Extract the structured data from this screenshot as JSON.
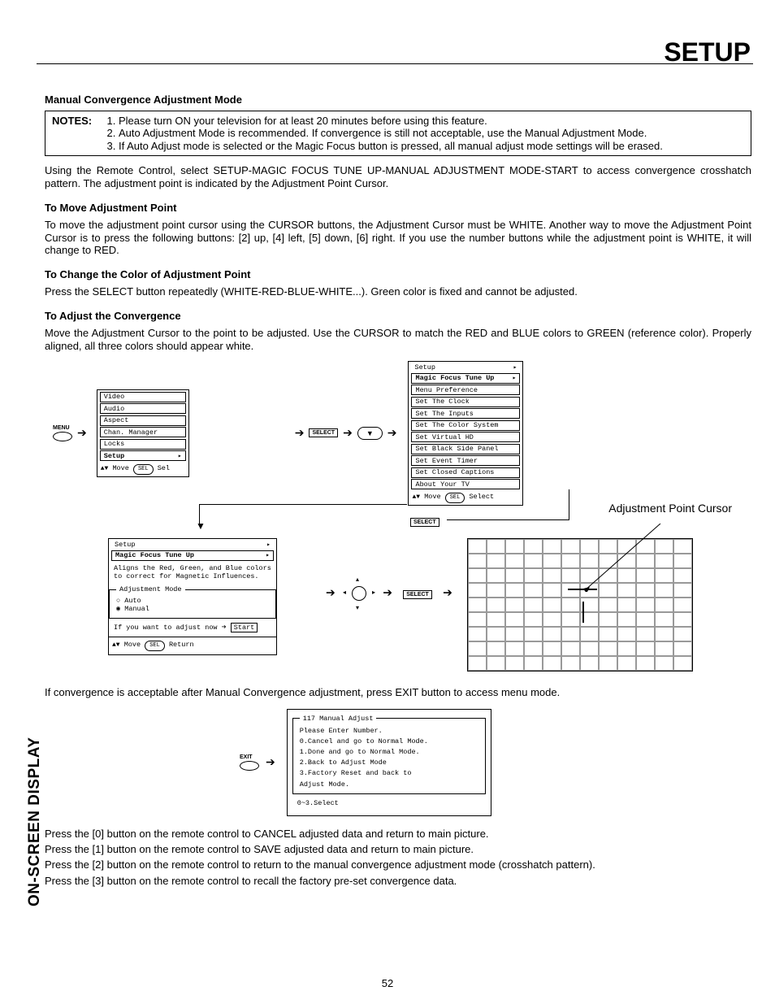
{
  "title": "Setup",
  "section_heading": "Manual Convergence Adjustment Mode",
  "notes_label": "NOTES:",
  "notes": [
    "Please turn ON your television for at least 20 minutes before using this feature.",
    "Auto Adjustment Mode is recommended.  If convergence is still not acceptable, use the Manual Adjustment Mode.",
    "If Auto Adjust mode is selected or the Magic Focus button is pressed, all manual adjust mode settings will be erased."
  ],
  "intro": "Using the Remote Control, select SETUP-MAGIC FOCUS TUNE UP-MANUAL ADJUSTMENT MODE-START to access convergence crosshatch pattern.  The adjustment point is indicated by the Adjustment Point Cursor.",
  "move_h": "To Move Adjustment Point",
  "move_p": "To move the adjustment point cursor using the CURSOR buttons, the Adjustment Cursor must be WHITE.  Another way to move the Adjustment Point Cursor is to press the following buttons:  [2] up, [4] left, [5] down, [6] right.  If you use the number buttons while the adjustment point is WHITE, it will change to RED.",
  "color_h": "To Change the Color of Adjustment Point",
  "color_p": "Press the SELECT button repeatedly (WHITE-RED-BLUE-WHITE...).  Green color is fixed and cannot be adjusted.",
  "adjust_h": "To Adjust the Convergence",
  "adjust_p": "Move the Adjustment Cursor to the point to be adjusted.  Use the CURSOR to match the RED and BLUE colors to GREEN (reference color).  Properly aligned, all three colors should appear white.",
  "menu_label": "MENU",
  "select_label": "SELECT",
  "exit_label": "EXIT",
  "menu1": {
    "items": [
      "Video",
      "Audio",
      "Aspect",
      "Chan. Manager",
      "Locks"
    ],
    "sel": "Setup",
    "foot": "Move",
    "foot2": "Sel",
    "pill": "SEL"
  },
  "menu2": {
    "head": "Setup",
    "sel": "Magic Focus Tune Up",
    "items": [
      "Menu Preference",
      "Set The Clock",
      "Set The Inputs",
      "Set The Color System",
      "Set Virtual HD",
      "Set Black Side Panel",
      "Set Event Timer",
      "Set Closed Captions",
      "About Your TV"
    ],
    "foot": "Move",
    "foot2": "Select",
    "pill": "SEL"
  },
  "menu3": {
    "head": "Setup",
    "sel": "Magic Focus Tune Up",
    "desc": "Aligns the Red, Green, and Blue colors to correct for Magnetic Influences.",
    "legend": "Adjustment Mode",
    "opt_auto": "Auto",
    "opt_manual": "Manual",
    "if_text": "If you want to adjust now",
    "start": "Start",
    "foot": "Move",
    "foot2": "Return",
    "pill": "SEL"
  },
  "apc_label": "Adjustment Point Cursor",
  "after_text": "If convergence is acceptable after Manual Convergence adjustment, press EXIT button to access menu mode.",
  "exit_menu": {
    "legend": "117 Manual Adjust",
    "l1": "Please Enter Number.",
    "l2": "0.Cancel and go to Normal Mode.",
    "l3": "1.Done and go to Normal Mode.",
    "l4": "2.Back to Adjust Mode",
    "l5": "3.Factory Reset and back to",
    "l5b": "  Adjust Mode.",
    "foot": "0~3.Select"
  },
  "press0": "Press the [0] button on the remote control to CANCEL adjusted data and return to main picture.",
  "press1": "Press the [1] button on the remote control to SAVE adjusted data and return to main picture.",
  "press2": "Press the [2] button on the remote control to return to the manual convergence adjustment mode (crosshatch pattern).",
  "press3": "Press the [3] button on the remote control to recall the factory pre-set convergence data.",
  "side": "On-screen Display",
  "pagenum": "52"
}
